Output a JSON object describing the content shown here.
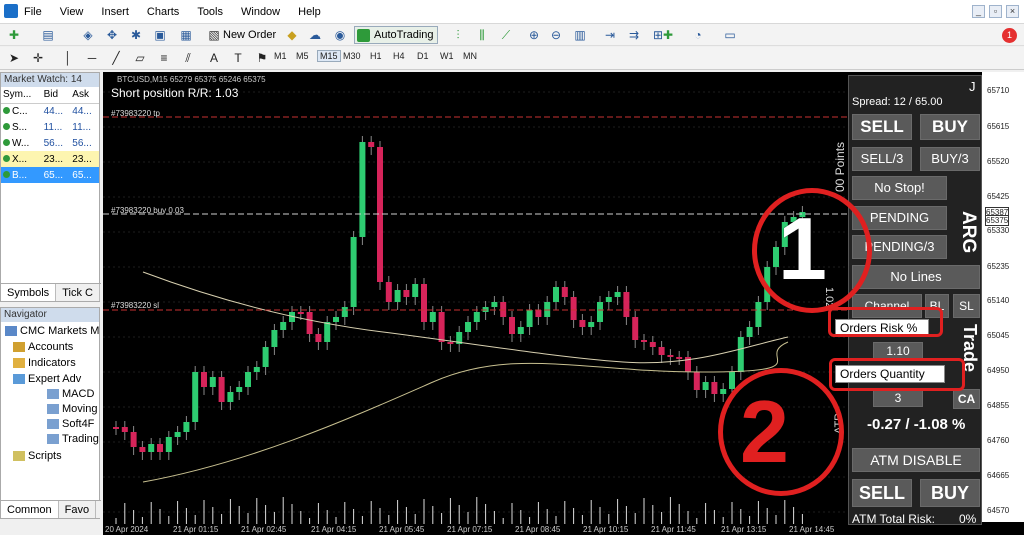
{
  "menubar": {
    "items": [
      "File",
      "View",
      "Insert",
      "Charts",
      "Tools",
      "Window",
      "Help"
    ],
    "notification_count": "1"
  },
  "toolbar": {
    "new_order_label": "New Order",
    "autotrading_label": "AutoTrading",
    "timeframes": [
      "M1",
      "M5",
      "M15",
      "M30",
      "H1",
      "H4",
      "D1",
      "W1",
      "MN"
    ],
    "active_timeframe": "M15"
  },
  "market_watch": {
    "title": "Market Watch: 14",
    "columns": [
      "Sym...",
      "Bid",
      "Ask"
    ],
    "rows": [
      {
        "symbol": "C...",
        "bid": "44...",
        "ask": "44..."
      },
      {
        "symbol": "S...",
        "bid": "11...",
        "ask": "11..."
      },
      {
        "symbol": "W...",
        "bid": "56...",
        "ask": "56..."
      },
      {
        "symbol": "X...",
        "bid": "23...",
        "ask": "23..."
      },
      {
        "symbol": "B...",
        "bid": "65...",
        "ask": "65..."
      }
    ],
    "tabs": [
      "Symbols",
      "Tick C"
    ]
  },
  "navigator": {
    "title": "Navigator",
    "items": [
      "CMC Markets M",
      "Accounts",
      "Indicators",
      "Expert Adv",
      "MACD",
      "Moving",
      "Soft4F",
      "Trading",
      "Scripts"
    ],
    "tabs": [
      "Common",
      "Favo"
    ]
  },
  "chart": {
    "header": "BTCUSD,M15  65279 65375 65246 65375",
    "rr_text": "Short position R/R: 1.03",
    "tp_label": "#73983220 tp",
    "buy_label": "#73983220 buy 0.03",
    "sl_label": "#73983220 sl",
    "y_ticks": [
      "65710",
      "65615",
      "65520",
      "65425",
      "65330",
      "65235",
      "65140",
      "65045",
      "64950",
      "64855",
      "64760",
      "64665",
      "64570"
    ],
    "price_tag_1": "65387",
    "price_tag_2": "65375",
    "x_ticks": [
      "20 Apr 2024",
      "21 Apr 01:15",
      "21 Apr 02:45",
      "21 Apr 04:15",
      "21 Apr 05:45",
      "21 Apr 07:15",
      "21 Apr 08:45",
      "21 Apr 10:15",
      "21 Apr 11:45",
      "21 Apr 13:15",
      "21 Apr 14:45"
    ],
    "side_text_points": "00 Points",
    "side_text_arg": "ARG",
    "side_text_trade": "Trade",
    "side_text_atp": "ATP",
    "side_text_num": "1.02"
  },
  "panel": {
    "corner": "J",
    "spread": "Spread: 12 / 65.00",
    "sell": "SELL",
    "buy": "BUY",
    "sell3": "SELL/3",
    "buy3": "BUY/3",
    "nostop": "No Stop!",
    "pending": "PENDING",
    "pending3": "PENDING/3",
    "nolines": "No Lines",
    "channel": "Channel",
    "bl": "BL",
    "sl": "SL",
    "orders_risk_label": "Orders Risk %",
    "orders_risk_value": "1.10",
    "orders_qty_label": "Orders Quantity",
    "orders_qty_value": "3",
    "ca": "CA",
    "pnl": "-0.27 / -1.08 %",
    "atm_disable": "ATM DISABLE",
    "sell2": "SELL",
    "buy2": "BUY",
    "atm_risk": "ATM Total Risk:",
    "atm_risk_value": "0%"
  },
  "annotations": {
    "num1": "1",
    "num2": "2"
  },
  "colors": {
    "bull": "#2ecc71",
    "bear": "#d6245a",
    "annotation": "#e02020",
    "tp_line": "#c83232"
  }
}
